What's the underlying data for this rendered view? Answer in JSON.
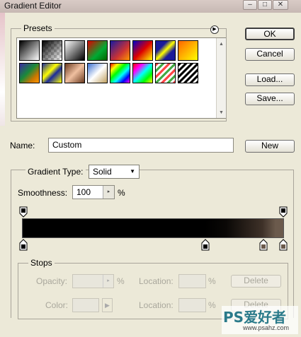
{
  "window": {
    "title": "Gradient Editor"
  },
  "presets": {
    "label": "Presets"
  },
  "buttons": {
    "ok": "OK",
    "cancel": "Cancel",
    "load": "Load...",
    "save": "Save...",
    "new": "New",
    "delete": "Delete"
  },
  "name": {
    "label": "Name:",
    "value": "Custom"
  },
  "gradient_type": {
    "label": "Gradient Type:",
    "value": "Solid"
  },
  "smoothness": {
    "label": "Smoothness:",
    "value": "100",
    "unit": "%"
  },
  "stops": {
    "label": "Stops",
    "opacity_label": "Opacity:",
    "opacity_unit": "%",
    "color_label": "Color:",
    "location_label": "Location:",
    "location_unit": "%"
  },
  "watermark": {
    "text": "PS爱好者",
    "url": "www.psahz.com"
  },
  "colors": {
    "gradient_start": "#000000",
    "gradient_mid": "#000000",
    "gradient_end": "#6b5a4c"
  }
}
